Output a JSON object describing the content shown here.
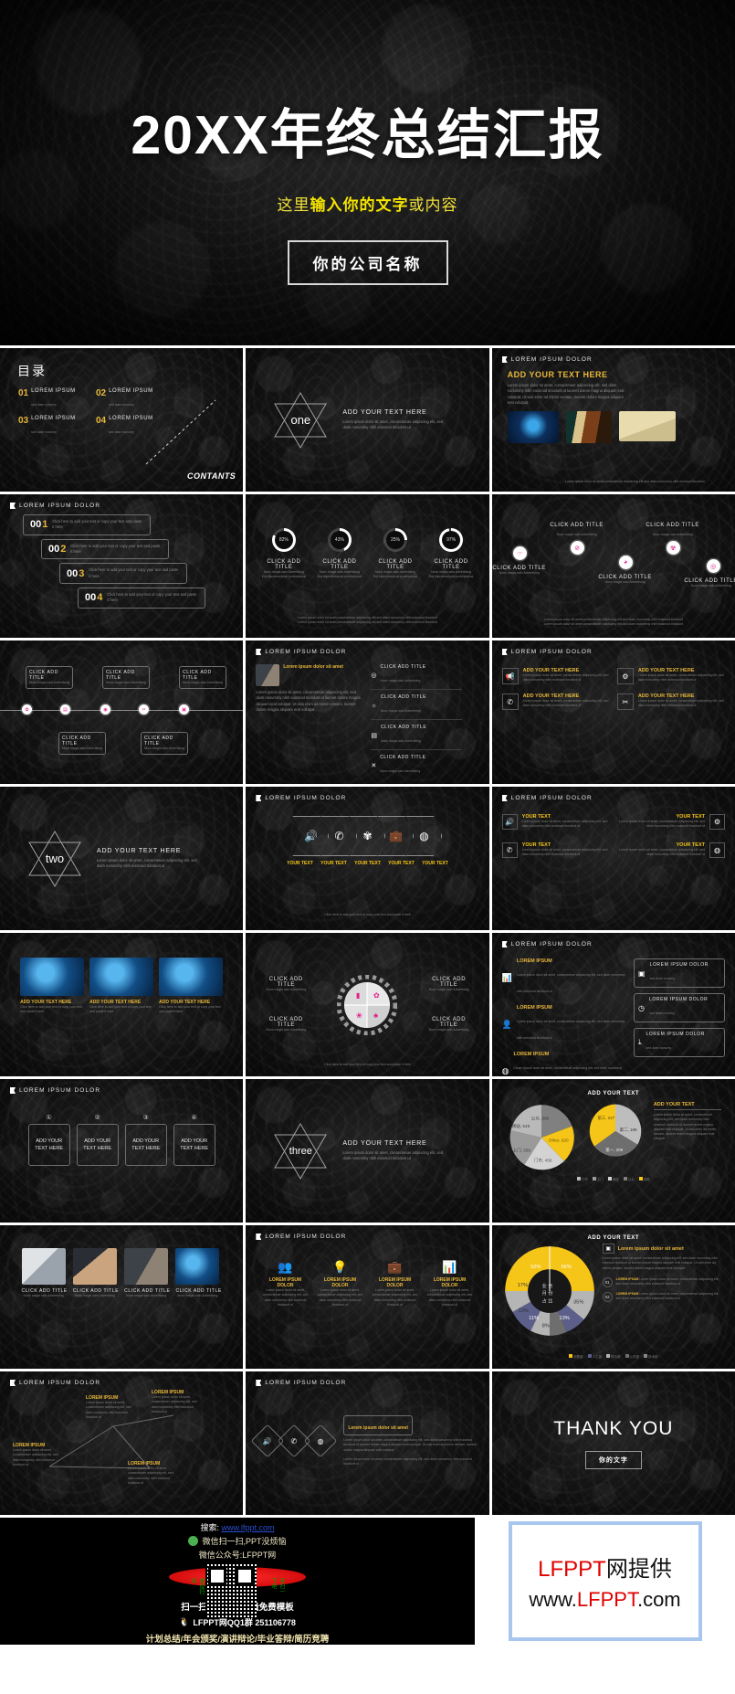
{
  "hero": {
    "title": "20XX年终总结汇报",
    "subtitle_pre": "这里",
    "subtitle_bold": "输入你的文字",
    "subtitle_post": "或内容",
    "company": "你的公司名称",
    "accent_yellow": "#f5e500"
  },
  "common": {
    "header": "LOREM IPSUM DOLOR",
    "click_add_title": "CLICK ADD TITLE",
    "add_your_text_here": "ADD YOUR TEXT HERE",
    "add_your_text": "ADD YOUR TEXT",
    "your_text": "YOUR TEXT",
    "lorem_short": "Lorem ipsum dolor sit amet, consectetuer adipiscing elit, sed diam nonummy nibh euismod tincidunt ut",
    "lorem_body": "Lorem ipsum dolor sit amet, consectetuer adipiscing elit, sed diam nonummy nibh euismod tincidunt ut laoreet dolore magna aliquam erat volutpat. Ut wisi enim ad minim veniam, laoreet dolore magna aliquam erat volutpat.",
    "click_here": "Click here to add your text or copy your text and paste it here",
    "nunc_line1": "Nunc magis sain Advertising",
    "nunc_line2": "Est bilprofessional professional",
    "foot_line": "Lorem ipsum dolor sit amet,consectetuer adipiscing elit,sed diam nonummy nibh euismod tincidunt",
    "gold": "#e9b83a",
    "pink": "#e0218a",
    "yellow": "#f5c518"
  },
  "slides": [
    {
      "id": "toc",
      "title": "目录",
      "contants": "CONTANTS",
      "items": [
        {
          "num": "01",
          "label": "LOREM IPSUM",
          "sub": "sed diam nonumy"
        },
        {
          "num": "02",
          "label": "LOREM IPSUM",
          "sub": "sed diam nonumy"
        },
        {
          "num": "03",
          "label": "LOREM IPSUM",
          "sub": "sed diam nonumy"
        },
        {
          "num": "04",
          "label": "LOREM IPSUM",
          "sub": "sed diam nonumy"
        }
      ]
    },
    {
      "id": "section-one",
      "word": "one",
      "heading": "ADD YOUR TEXT HERE"
    },
    {
      "id": "three-images",
      "heading": "ADD YOUR TEXT HERE"
    },
    {
      "id": "steps",
      "steps": [
        {
          "num": "00",
          "accent": "1"
        },
        {
          "num": "00",
          "accent": "2"
        },
        {
          "num": "00",
          "accent": "3"
        },
        {
          "num": "00",
          "accent": "4"
        }
      ]
    },
    {
      "id": "rings",
      "rings": [
        {
          "pct": 82,
          "label": "82%"
        },
        {
          "pct": 43,
          "label": "43%"
        },
        {
          "pct": 25,
          "label": "25%"
        },
        {
          "pct": 97,
          "label": "97%"
        }
      ]
    },
    {
      "id": "pink-zigzag",
      "count": 5
    },
    {
      "id": "timeline",
      "count": 5
    },
    {
      "id": "photo-list",
      "heading": "Lorem ipsum dolor sit amet"
    },
    {
      "id": "four-icons",
      "heading": "ADD YOUR TEXT HERE"
    },
    {
      "id": "section-two",
      "word": "two",
      "heading": "ADD YOUR TEXT HERE"
    },
    {
      "id": "chevrons",
      "count": 5
    },
    {
      "id": "quad-icons",
      "count": 4
    },
    {
      "id": "three-photos",
      "count": 3
    },
    {
      "id": "gear",
      "count": 4
    },
    {
      "id": "icon-rows",
      "count": 4
    },
    {
      "id": "four-cards",
      "cards": [
        "ADD YOUR TEXT HERE",
        "ADD YOUR TEXT HERE",
        "ADD YOUR TEXT HERE",
        "ADD YOUR TEXT HERE"
      ]
    },
    {
      "id": "section-three",
      "word": "three",
      "heading": "ADD YOUR TEXT HERE"
    },
    {
      "id": "pies",
      "heading": "ADD YOUR TEXT"
    },
    {
      "id": "photo-grid",
      "count": 4
    },
    {
      "id": "icon-four",
      "count": 4
    },
    {
      "id": "donut",
      "heading": "ADD YOUR TEXT"
    },
    {
      "id": "diagram",
      "heading": "LOREM IPSUM"
    },
    {
      "id": "diamonds",
      "heading": "Lorem ipsum dolor sit amet"
    },
    {
      "id": "thanks",
      "title": "THANK YOU",
      "button": "你的文字"
    }
  ],
  "chart_data": [
    {
      "type": "pie",
      "title": "ADD YOUR TEXT",
      "chart_index": 1,
      "categories": [
        "门市, 458",
        "上门, 556",
        "网站, 549",
        "公众, 689",
        "Other, 620"
      ],
      "values": [
        458,
        556,
        549,
        689,
        620
      ],
      "colors": [
        "#b9b9b9",
        "#9a9a9a",
        "#d3d3d3",
        "#808080",
        "#f5c518"
      ],
      "legend_position": "bottom"
    },
    {
      "type": "pie",
      "title": "ADD YOUR TEXT",
      "chart_index": 2,
      "categories": [
        "第三, 227",
        "第二, 189",
        "第一, 206"
      ],
      "values": [
        227,
        189,
        206
      ],
      "colors": [
        "#f5c518",
        "#bdbdbd",
        "#6e6e6e"
      ],
      "legend_position": "bottom"
    },
    {
      "type": "pie",
      "title": "ADD YOUR TEXT",
      "chart_index": 3,
      "subtype": "donut",
      "categories": [
        "销售部",
        "人工部",
        "财务部",
        "公关部",
        "技术部"
      ],
      "values": [
        52,
        56,
        35,
        13,
        13,
        11,
        8,
        17
      ],
      "labels": [
        "52%",
        "56%",
        "35%",
        "13%",
        "13%",
        "11%",
        "8%",
        "17%"
      ],
      "colors": [
        "#f5c518",
        "#f5c518",
        "#b5b5b5",
        "#5b5f8a",
        "#5b5f8a",
        "#6e6e6e",
        "#b5b5b5",
        "#b5b5b5"
      ],
      "center_label": "业务月份占比",
      "legend_position": "bottom"
    }
  ],
  "footer": {
    "search_prefix": "搜索:",
    "search_url": "www.lfppt.com",
    "wechat_line": "微信扫一扫,PPT没烦恼",
    "account_line": "微信公众号:LFPPT网",
    "qr_left": "微信扫码",
    "qr_right": "手扫一下吧",
    "scan_line": "扫一扫即刻拥有海量免费模板",
    "qq_line": "LFPPT网QQ1群 251106778",
    "tags_line": "计划总结/年会颁奖/演讲辩论/毕业答辩/简历竞聘"
  },
  "watermark": {
    "line1_red": "LFPPT",
    "line1_black": "网提供",
    "line2_pre": "www.",
    "line2_red": "LFPPT",
    "line2_post": ".com",
    "border_color": "#a8c6ee"
  }
}
